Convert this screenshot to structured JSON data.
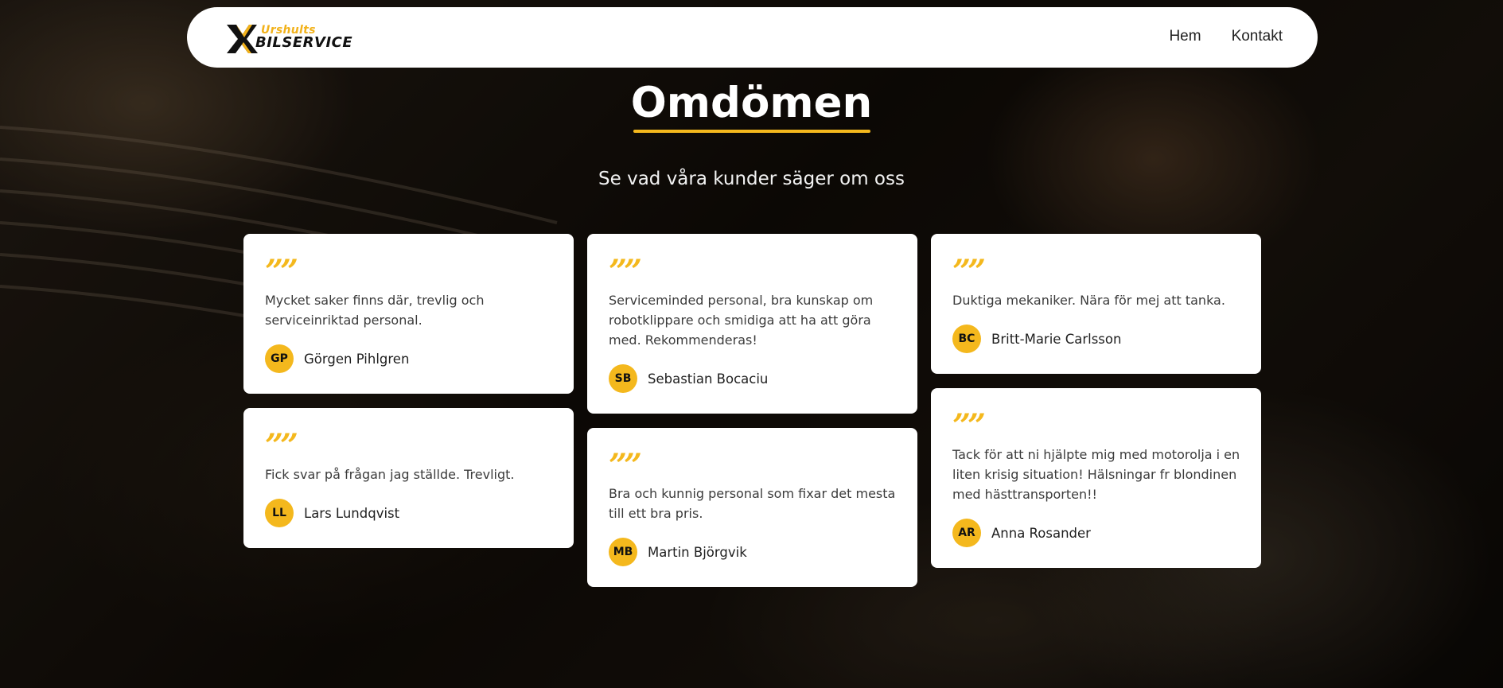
{
  "header": {
    "logo_top": "Urshults",
    "logo_bottom": "BILSERVICE",
    "nav": [
      {
        "label": "Hem"
      },
      {
        "label": "Kontakt"
      }
    ]
  },
  "section": {
    "title": "Omdömen",
    "subtitle": "Se vad våra kunder säger om oss"
  },
  "quote_glyph": "””",
  "reviews": [
    {
      "text": "Mycket saker finns där, trevlig och serviceinriktad personal.",
      "initials": "GP",
      "name": "Görgen Pihlgren"
    },
    {
      "text": "Fick svar på frågan jag ställde. Trevligt.",
      "initials": "LL",
      "name": "Lars Lundqvist"
    },
    {
      "text": "Serviceminded personal, bra kunskap om robotklippare och smidiga att ha att göra med. Rekommenderas!",
      "initials": "SB",
      "name": "Sebastian Bocaciu"
    },
    {
      "text": "Bra och kunnig personal som fixar det mesta till ett bra pris.",
      "initials": "MB",
      "name": "Martin Björgvik"
    },
    {
      "text": "Duktiga mekaniker. Nära för mej att tanka.",
      "initials": "BC",
      "name": "Britt-Marie Carlsson"
    },
    {
      "text": "Tack för att ni hjälpte mig med motorolja i en liten krisig situation! Hälsningar fr blondinen med hästtransporten!!",
      "initials": "AR",
      "name": "Anna Rosander"
    }
  ],
  "colors": {
    "accent": "#f4b81d",
    "card_bg": "#ffffff",
    "text": "#3b3b3b"
  },
  "icons": {
    "quote": "quote-icon",
    "logo_mark": "x-logo-icon"
  }
}
